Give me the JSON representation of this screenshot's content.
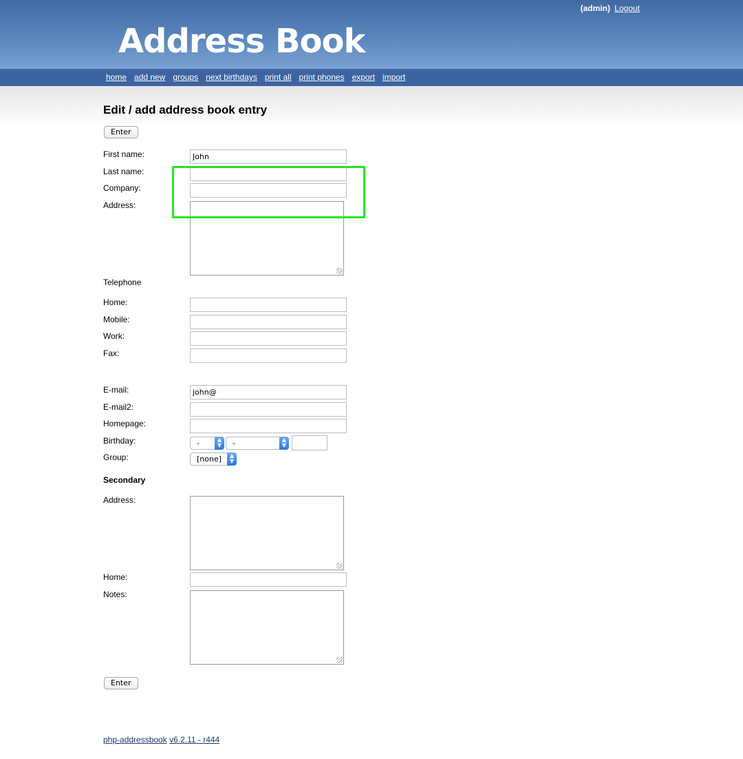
{
  "header": {
    "user": "(admin)",
    "logout": "Logout",
    "logo": "Address Book"
  },
  "nav": [
    "home",
    "add new",
    "groups",
    "next birthdays",
    "print all",
    "print phones",
    "export",
    "import"
  ],
  "page_title": "Edit / add address book entry",
  "enter_button": "Enter",
  "form": {
    "first_name": {
      "label": "First name:",
      "value": "John"
    },
    "last_name": {
      "label": "Last name:",
      "value": ""
    },
    "company": {
      "label": "Company:",
      "value": ""
    },
    "address": {
      "label": "Address:"
    },
    "telephone_heading": "Telephone",
    "home": {
      "label": "Home:",
      "value": ""
    },
    "mobile": {
      "label": "Mobile:",
      "value": ""
    },
    "work": {
      "label": "Work:",
      "value": ""
    },
    "fax": {
      "label": "Fax:",
      "value": ""
    },
    "email": {
      "label": "E-mail:",
      "value": "john@"
    },
    "email2": {
      "label": "E-mail2:",
      "value": ""
    },
    "homepage": {
      "label": "Homepage:",
      "value": ""
    },
    "birthday": {
      "label": "Birthday:",
      "day": "-",
      "month": "-"
    },
    "group": {
      "label": "Group:",
      "value": "[none]"
    },
    "secondary_heading": "Secondary",
    "address2": {
      "label": "Address:"
    },
    "home2": {
      "label": "Home:",
      "value": ""
    },
    "notes": {
      "label": "Notes:"
    }
  },
  "footer": {
    "app": "php-addressbook",
    "version": "v6.2.11 - r444"
  },
  "colors": {
    "header_top": "#3f6aa3",
    "nav_bar": "#3c65a0",
    "highlight": "#22e622"
  }
}
